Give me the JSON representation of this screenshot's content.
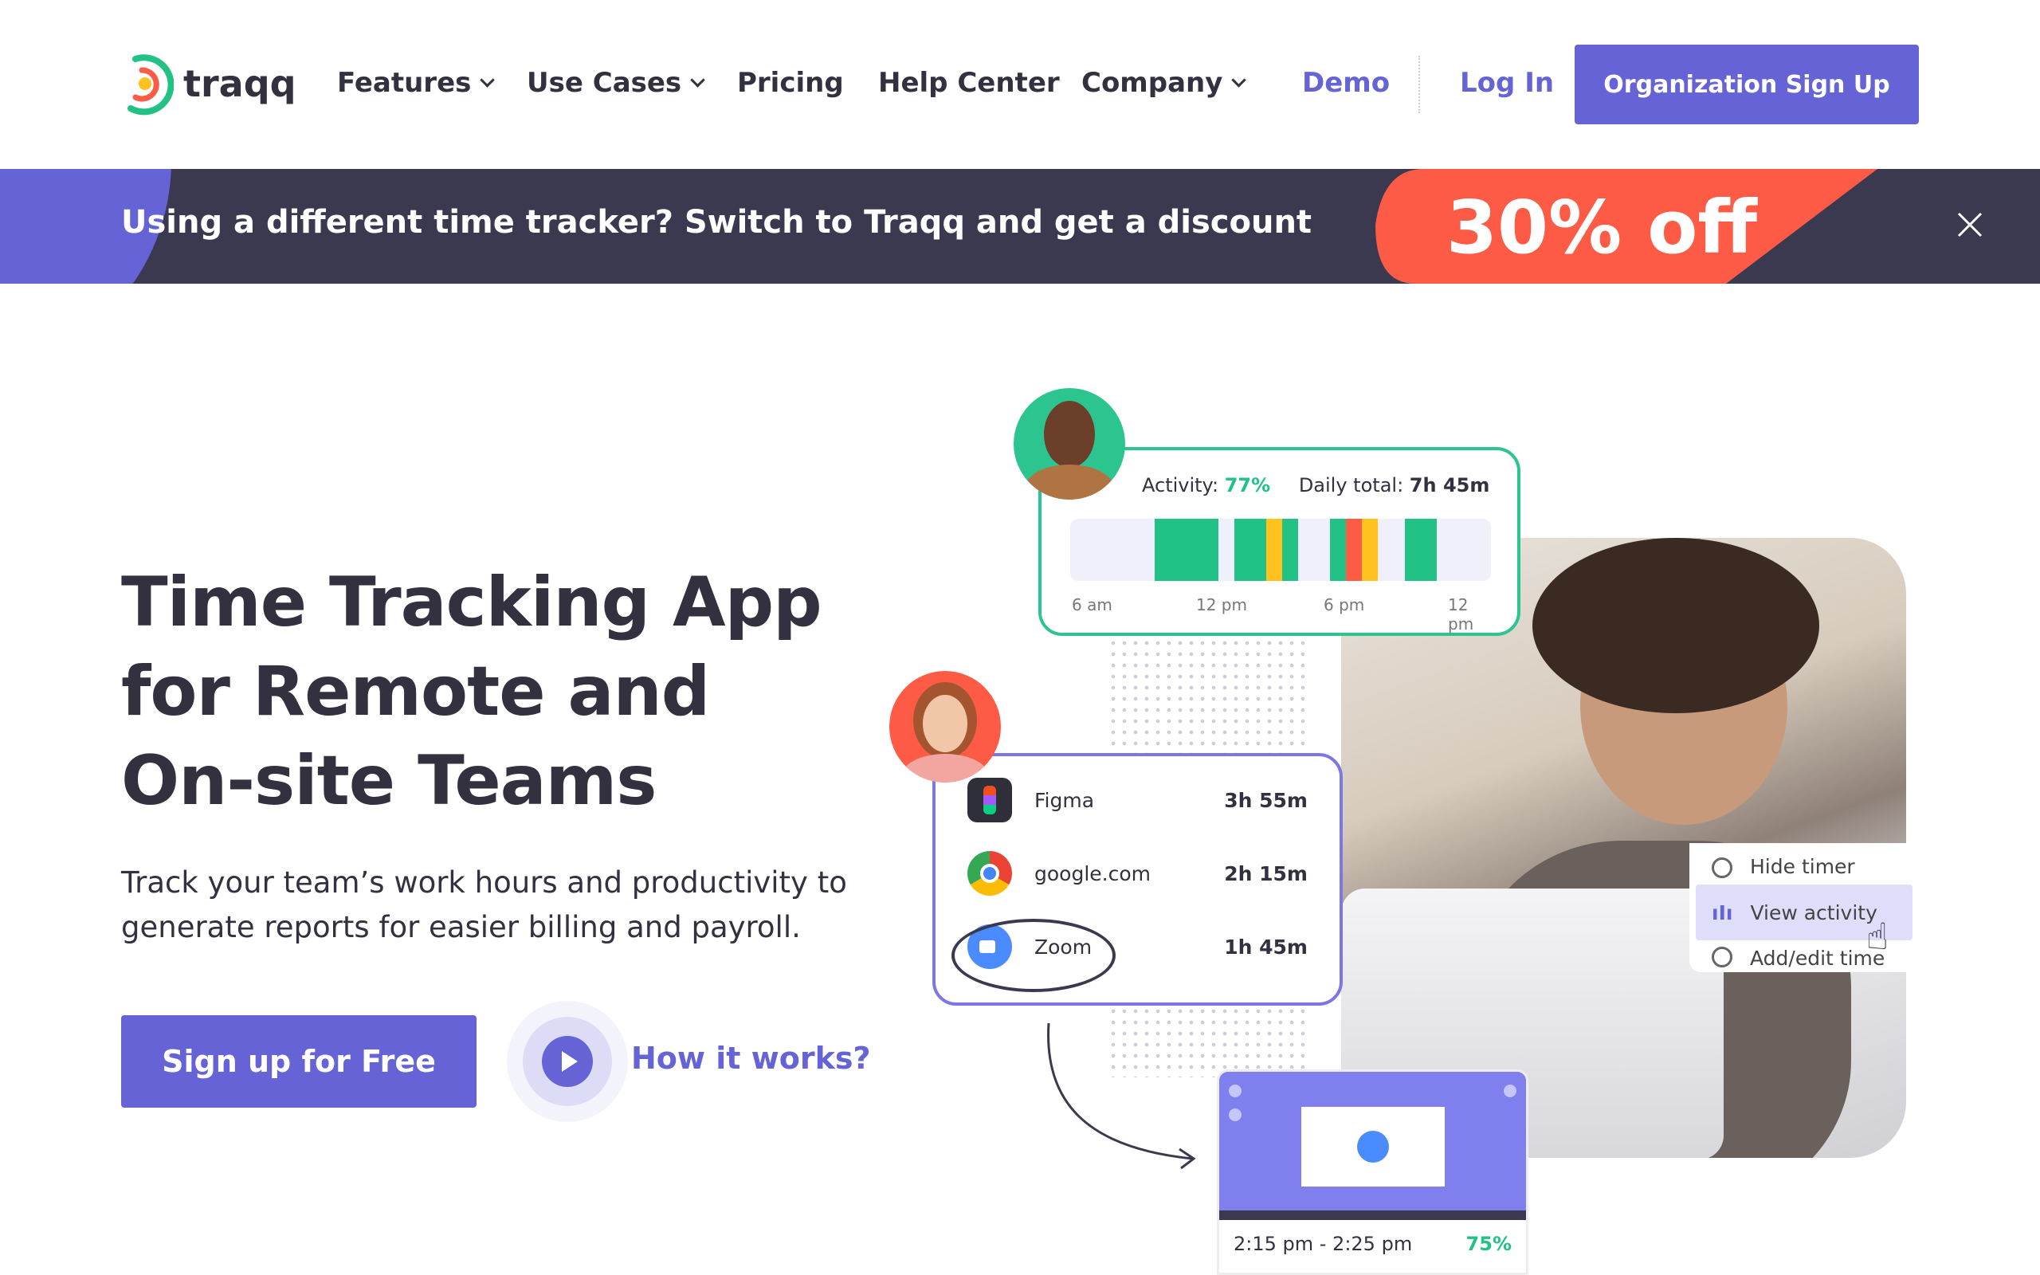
{
  "nav": {
    "logo": "traqq",
    "items": [
      {
        "label": "Features",
        "dropdown": true
      },
      {
        "label": "Use Cases",
        "dropdown": true
      },
      {
        "label": "Pricing"
      },
      {
        "label": "Help Center"
      },
      {
        "label": "Company",
        "dropdown": true
      }
    ],
    "demo": "Demo",
    "login": "Log In",
    "signup": "Organization Sign Up"
  },
  "banner": {
    "text": "Using a different time tracker? Switch to Traqq and get a discount",
    "offer": "30% off",
    "close_icon": "close-icon"
  },
  "hero": {
    "title_lines": [
      "Time Tracking App",
      "for Remote and",
      "On-site Teams"
    ],
    "subtitle": "Track your team’s work hours and productivity to generate reports for easier billing and payroll.",
    "cta": "Sign up for Free",
    "how": "How it works?"
  },
  "activity_card": {
    "activity_label": "Activity:",
    "activity_value": "77%",
    "total_label": "Daily total:",
    "total_value": "7h 45m",
    "ticks": [
      "6 am",
      "12 pm",
      "6 pm",
      "12 pm"
    ]
  },
  "apps": [
    {
      "name": "Figma",
      "time": "3h 55m"
    },
    {
      "name": "google.com",
      "time": "2h 15m"
    },
    {
      "name": "Zoom",
      "time": "1h 45m"
    }
  ],
  "menu": {
    "items": [
      "Hide timer",
      "View activity",
      "Add/edit time"
    ]
  },
  "screenshot_card": {
    "range": "2:15 pm - 2:25 pm",
    "activity": "75%"
  },
  "colors": {
    "primary": "#6563d6",
    "green": "#22c185",
    "red": "#fd5b45",
    "yellow": "#ffc21f",
    "banner": "#3a3950"
  }
}
